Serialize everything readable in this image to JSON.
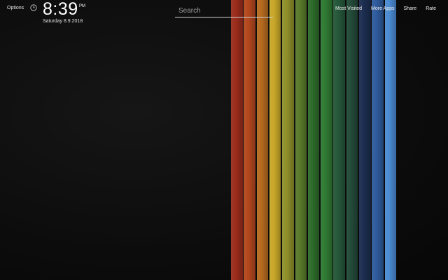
{
  "header": {
    "options_label": "Options",
    "clock_icon": "clock-icon",
    "time": "8:39",
    "ampm": "PM",
    "date": "Saturday  8.9.2018"
  },
  "search": {
    "placeholder": "Search",
    "value": ""
  },
  "nav": {
    "links": [
      "Most Visited",
      "More Apps",
      "Share",
      "Rate"
    ]
  },
  "wallpaper": {
    "background": "#0b0b0b",
    "stripes": [
      "#9b2c1c",
      "#b3471e",
      "#b66a1f",
      "#c9a829",
      "#8e8f2a",
      "#5a7a2a",
      "#2d6b2b",
      "#2f7a33",
      "#25573a",
      "#234a39",
      "#1c2d4f",
      "#2f5b9c",
      "#4a8ad0"
    ]
  }
}
